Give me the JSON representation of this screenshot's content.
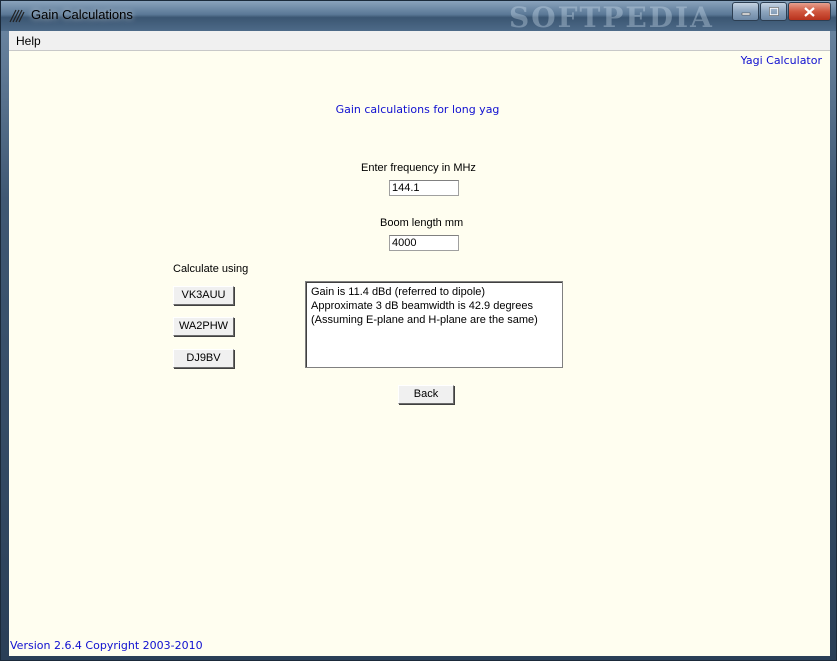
{
  "window": {
    "title": "Gain Calculations",
    "watermark": "SOFTPEDIA"
  },
  "menu": {
    "help": "Help"
  },
  "header": {
    "app_link": "Yagi Calculator",
    "heading": "Gain calculations for long yag"
  },
  "frequency": {
    "label": "Enter frequency in MHz",
    "value": "144.1"
  },
  "boom": {
    "label": "Boom length mm",
    "value": "4000"
  },
  "calculate": {
    "label": "Calculate using",
    "buttons": [
      "VK3AUU",
      "WA2PHW",
      "DJ9BV"
    ]
  },
  "result": {
    "lines": [
      "Gain is 11.4 dBd (referred to dipole)",
      "Approximate 3 dB beamwidth is 42.9 degrees",
      "(Assuming E-plane and H-plane are the same)"
    ]
  },
  "back_label": "Back",
  "footer": {
    "text": "Version 2.6.4   Copyright 2003-2010"
  },
  "colors": {
    "client_bg": "#fffef0",
    "accent_text": "#1010d0"
  }
}
